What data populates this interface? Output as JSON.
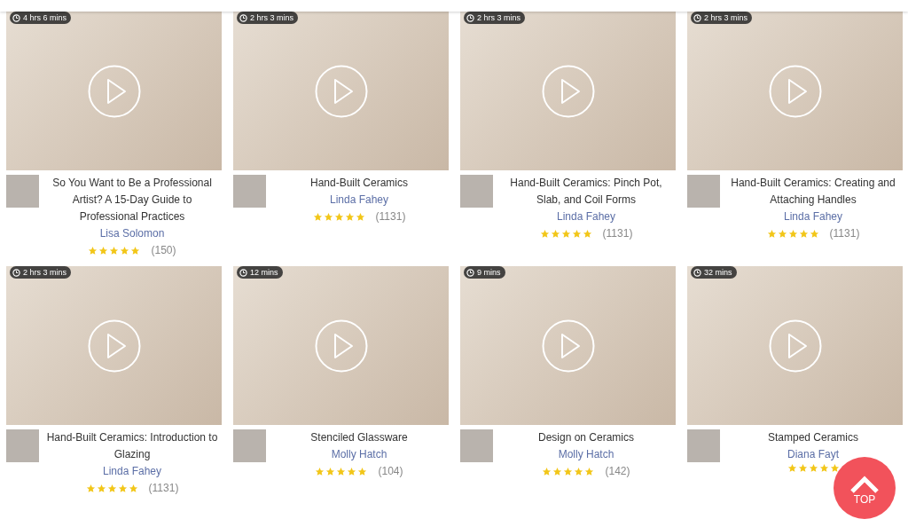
{
  "courses": [
    {
      "duration": "4 hrs 6 mins",
      "title": "So You Want to Be a Professional Artist? A 15-Day Guide to Professional Practices",
      "author": "Lisa Solomon",
      "stars": 5,
      "reviews": "(150)"
    },
    {
      "duration": "2 hrs 3 mins",
      "title": "Hand-Built Ceramics",
      "author": "Linda Fahey",
      "stars": 5,
      "reviews": "(1131)"
    },
    {
      "duration": "2 hrs 3 mins",
      "title": "Hand-Built Ceramics: Pinch Pot, Slab, and Coil Forms",
      "author": "Linda Fahey",
      "stars": 5,
      "reviews": "(1131)"
    },
    {
      "duration": "2 hrs 3 mins",
      "title": "Hand-Built Ceramics: Creating and Attaching Handles",
      "author": "Linda Fahey",
      "stars": 5,
      "reviews": "(1131)"
    },
    {
      "duration": "2 hrs 3 mins",
      "title": "Hand-Built Ceramics: Introduction to Glazing",
      "author": "Linda Fahey",
      "stars": 5,
      "reviews": "(1131)"
    },
    {
      "duration": "12 mins",
      "title": "Stenciled Glassware",
      "author": "Molly Hatch",
      "stars": 5,
      "reviews": "(104)"
    },
    {
      "duration": "9 mins",
      "title": "Design on Ceramics",
      "author": "Molly Hatch",
      "stars": 5,
      "reviews": "(142)"
    },
    {
      "duration": "32 mins",
      "title": "Stamped Ceramics",
      "author": "Diana Fayt",
      "stars": 5
    }
  ],
  "top_button": {
    "label": "TOP"
  }
}
